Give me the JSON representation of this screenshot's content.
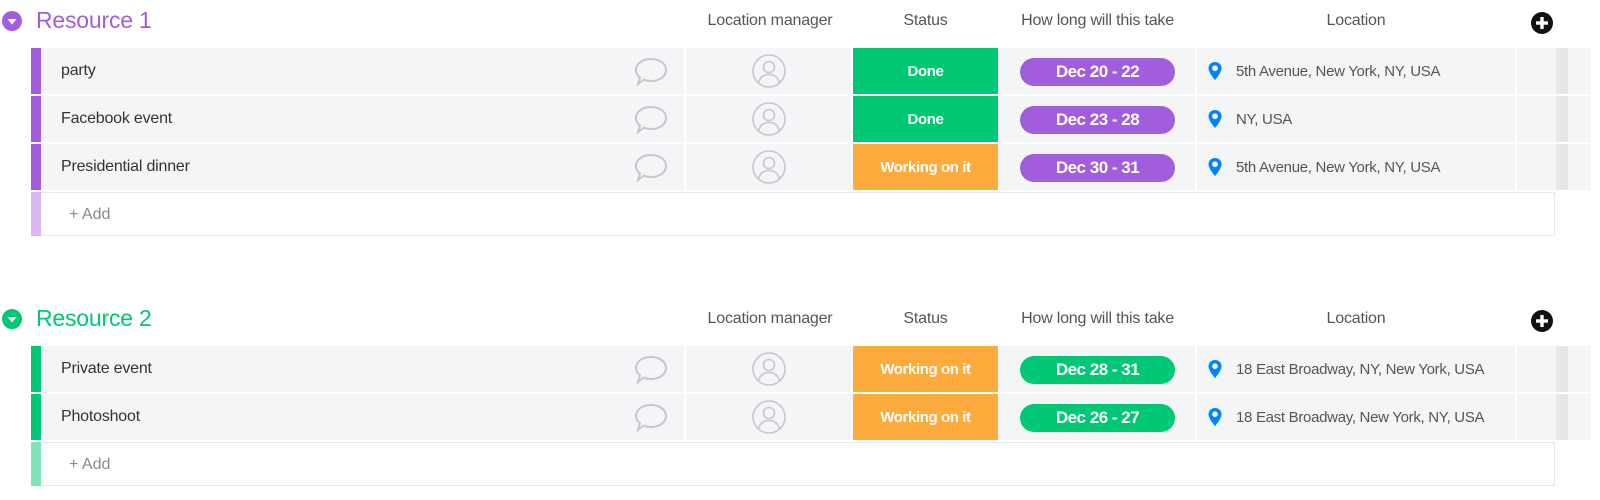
{
  "columns": {
    "location_manager": "Location manager",
    "status": "Status",
    "timeline": "How long will this take",
    "location": "Location"
  },
  "colors": {
    "purple": "#a25ddc",
    "purple_light": "#d9b8f0",
    "green": "#00c875",
    "green_light": "#7fe3b8",
    "status_done": "#00c875",
    "status_working": "#fdab3d",
    "pin": "#0085ff"
  },
  "groups": [
    {
      "title": "Resource 1",
      "color": "#a25ddc",
      "add_label": "+ Add",
      "items": [
        {
          "name": "party",
          "status": "Done",
          "timeline": "Dec 20 - 22",
          "location": "5th Avenue, New York, NY, USA"
        },
        {
          "name": "Facebook event",
          "status": "Done",
          "timeline": "Dec 23 - 28",
          "location": "NY, USA"
        },
        {
          "name": "Presidential dinner",
          "status": "Working on it",
          "timeline": "Dec 30 - 31",
          "location": "5th Avenue, New York, NY, USA"
        }
      ]
    },
    {
      "title": "Resource 2",
      "color": "#00c875",
      "add_label": "+ Add",
      "items": [
        {
          "name": "Private event",
          "status": "Working on it",
          "timeline": "Dec 28 - 31",
          "location": "18 East Broadway, NY, New York, USA"
        },
        {
          "name": "Photoshoot",
          "status": "Working on it",
          "timeline": "Dec 26 - 27",
          "location": "18 East Broadway, New York, NY, USA"
        }
      ]
    }
  ]
}
